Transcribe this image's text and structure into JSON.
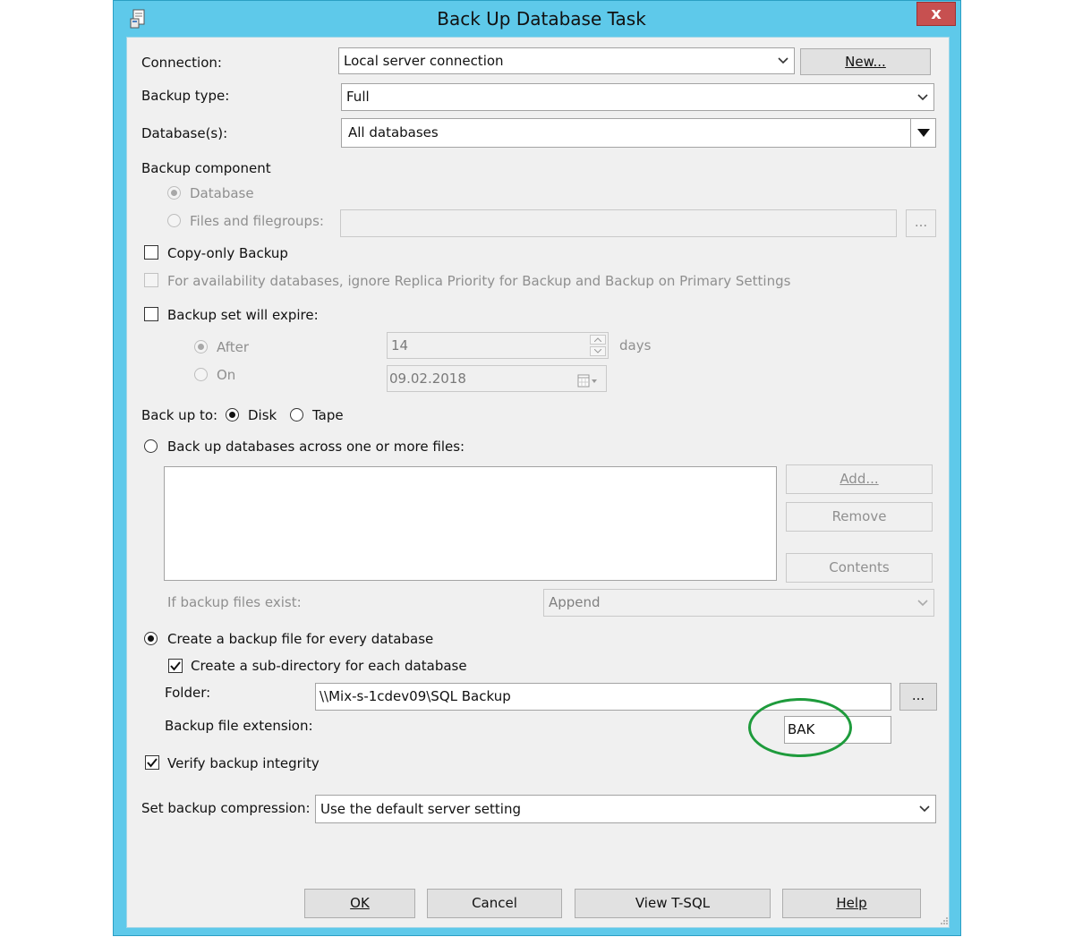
{
  "window": {
    "title": "Back Up Database Task",
    "close_glyph": "x"
  },
  "connection": {
    "label": "Connection:",
    "value": "Local server connection",
    "new_button": "New..."
  },
  "backup_type": {
    "label": "Backup type:",
    "value": "Full"
  },
  "databases": {
    "label": "Database(s):",
    "value": "All databases"
  },
  "backup_component": {
    "heading": "Backup component",
    "database_option": "Database",
    "files_option": "Files and filegroups:",
    "files_value": "",
    "browse_button": "..."
  },
  "copy_only": {
    "label": "Copy-only Backup",
    "checked": false
  },
  "availability": {
    "label": "For availability databases, ignore Replica Priority for Backup and Backup on Primary Settings",
    "checked": false
  },
  "expire": {
    "label": "Backup set will expire:",
    "checked": false,
    "after_label": "After",
    "after_value": "14",
    "days_label": "days",
    "on_label": "On",
    "on_value": "09.02.2018"
  },
  "backup_to": {
    "label": "Back up to:",
    "disk_label": "Disk",
    "tape_label": "Tape",
    "selected": "Disk"
  },
  "across_files": {
    "label": "Back up databases across one or more files:",
    "items": [],
    "add_button": "Add...",
    "remove_button": "Remove",
    "contents_button": "Contents"
  },
  "if_exists": {
    "label": "If backup files exist:",
    "value": "Append"
  },
  "per_database": {
    "label": "Create a backup file for every database",
    "selected": true
  },
  "subdirectory": {
    "label": "Create a sub-directory for each database",
    "checked": true
  },
  "folder": {
    "label": "Folder:",
    "value": "\\\\Mix-s-1cdev09\\SQL Backup",
    "browse_button": "..."
  },
  "extension": {
    "label": "Backup file extension:",
    "value": "BAK"
  },
  "verify": {
    "label": "Verify backup integrity",
    "checked": true
  },
  "compression": {
    "label": "Set backup compression:",
    "value": "Use the default server setting"
  },
  "footer": {
    "ok": "OK",
    "cancel": "Cancel",
    "view_tsql": "View T-SQL",
    "help": "Help"
  },
  "colors": {
    "title_bar": "#5ec9ea",
    "close_button": "#c75050",
    "annotation_ellipse": "#1e9b3c"
  },
  "icons": [
    "app-icon",
    "close-icon",
    "chevron-down-icon",
    "spin-up-icon",
    "spin-down-icon",
    "calendar-icon",
    "check-icon"
  ]
}
